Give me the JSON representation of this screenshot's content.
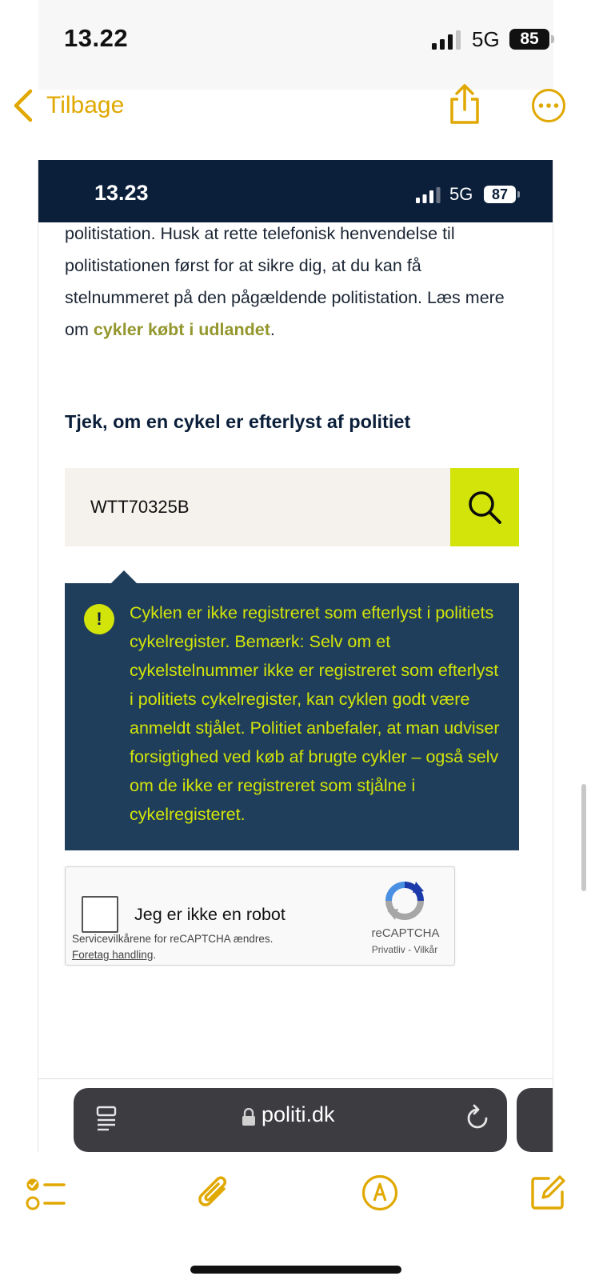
{
  "outer_status": {
    "time": "13.22",
    "network": "5G",
    "battery": "85"
  },
  "notes_nav": {
    "back_label": "Tilbage",
    "icons": [
      "chevron-left-icon",
      "share-icon",
      "more-icon"
    ],
    "accent_color": "#e0a800"
  },
  "screenshot": {
    "status": {
      "time": "13.23",
      "network": "5G",
      "battery": "87",
      "background": "#0b1f3a"
    },
    "body": {
      "text_before_link": "politistation. Husk at rette telefonisk henvendelse til politistationen først for at sikre dig, at du kan få stelnummeret på den pågældende politistation. Læs mere om ",
      "link_text": "cykler købt i udlandet",
      "text_after_link": "."
    },
    "heading": "Tjek, om en cykel er efterlyst af politiet",
    "search": {
      "value": "WTT70325B",
      "button_icon": "search-icon",
      "button_color": "#d2e40a"
    },
    "result": {
      "icon_symbol": "!",
      "text": "Cyklen er ikke registreret som efterlyst i politiets cykelregister. Bemærk: Selv om et cykelstelnummer ikke er registreret som efterlyst i politiets cykelregister, kan cyklen godt være anmeldt stjålet. Politiet anbefaler, at man udviser forsigtighed ved køb af brugte cykler – også selv om de ikke er registreret som stjålne i cykelregisteret.",
      "background": "#1f3e5c",
      "text_color": "#d2e40a"
    },
    "captcha": {
      "label": "Jeg er ikke en robot",
      "notice": "Servicevilkårene for reCAPTCHA ændres.",
      "action": "Foretag handling",
      "action_suffix": ".",
      "brand": "reCAPTCHA",
      "privacy": "Privatliv",
      "separator": " - ",
      "terms": "Vilkår"
    },
    "browser": {
      "url": "politi.dk",
      "icons": [
        "reader-icon",
        "lock-icon",
        "reload-icon"
      ]
    }
  },
  "toolbar": {
    "icons": [
      "checklist-icon",
      "paperclip-icon",
      "markup-icon",
      "compose-icon"
    ]
  }
}
